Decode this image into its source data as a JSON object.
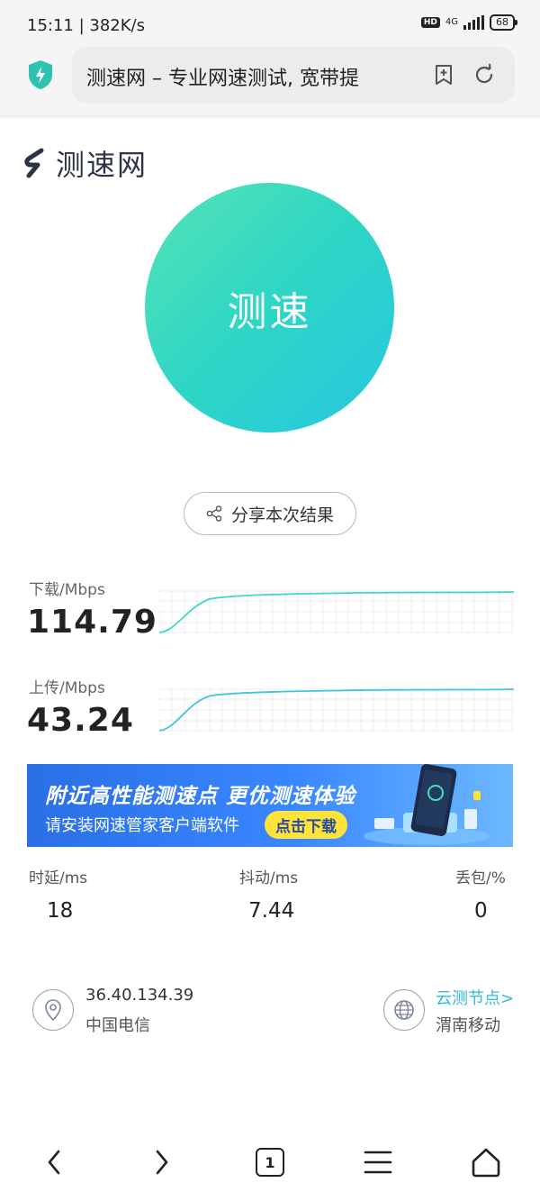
{
  "status_bar": {
    "time_speed": "15:11 | 382K/s",
    "hd_badge": "HD",
    "network": "4G",
    "battery": "68"
  },
  "browser": {
    "url_title": "测速网 – 专业网速测试, 宽带提",
    "icons": [
      "shield-lightning-icon",
      "bookmark-add-icon",
      "refresh-icon"
    ]
  },
  "site": {
    "logo_text": "测速网"
  },
  "speed_button": {
    "label": "测速"
  },
  "share": {
    "label": "分享本次结果"
  },
  "download": {
    "label": "下载/Mbps",
    "value": "114.79"
  },
  "upload": {
    "label": "上传/Mbps",
    "value": "43.24"
  },
  "banner": {
    "title": "附近高性能测速点  更优测速体验",
    "subtitle": "请安装网速管家客户端软件",
    "button": "点击下载"
  },
  "stats": {
    "latency_label": "时延/ms",
    "latency_value": "18",
    "jitter_label": "抖动/ms",
    "jitter_value": "7.44",
    "loss_label": "丢包/%",
    "loss_value": "0"
  },
  "client": {
    "ip": "36.40.134.39",
    "isp": "中国电信"
  },
  "node": {
    "link": "云测节点>",
    "name": "渭南移动"
  },
  "colors": {
    "accent_cyan": "#2fb9e0",
    "gradient_start": "#56e3b6",
    "gradient_end": "#27c6e2",
    "banner_blue": "#3987ff",
    "banner_button": "#ffe23a"
  },
  "bottom_nav": {
    "tab_count": "1",
    "icons": [
      "back-icon",
      "forward-icon",
      "tabs-icon",
      "menu-icon",
      "home-icon"
    ]
  }
}
